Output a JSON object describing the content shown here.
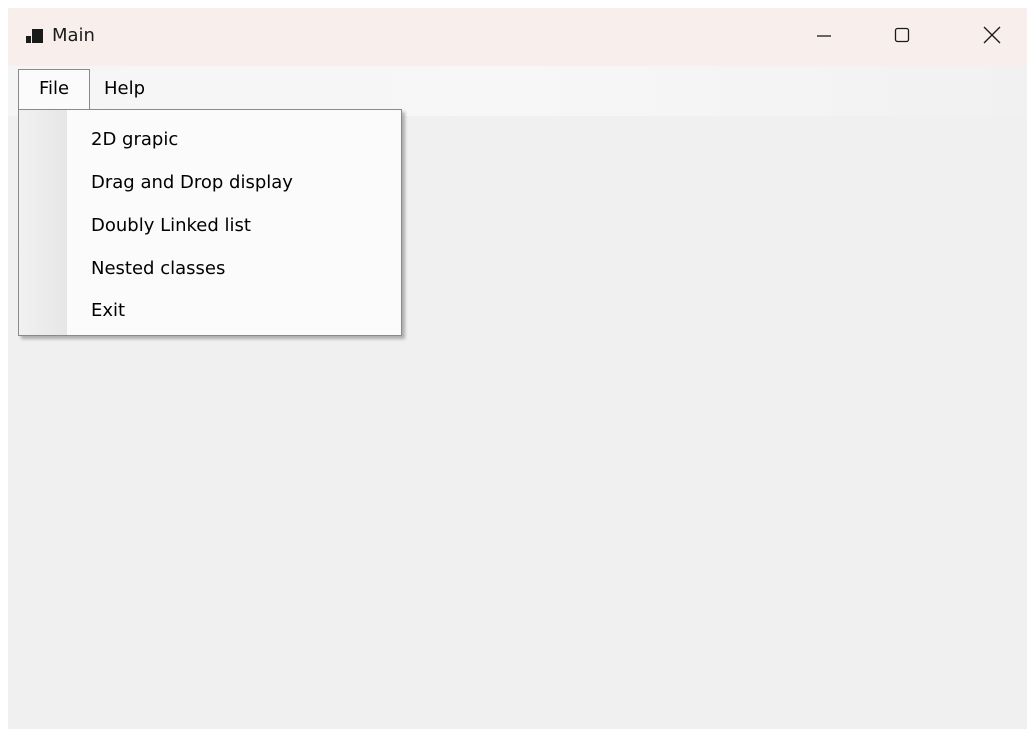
{
  "window": {
    "title": "Main",
    "app_icon": "window-app-icon",
    "caption_buttons": {
      "minimize_icon": "minimize-icon",
      "maximize_icon": "maximize-icon",
      "close_icon": "close-icon"
    }
  },
  "menubar": {
    "items": [
      {
        "label": "File",
        "open": true
      },
      {
        "label": "Help",
        "open": false
      }
    ]
  },
  "file_menu": {
    "items": [
      {
        "label": "2D grapic"
      },
      {
        "label": "Drag and Drop display"
      },
      {
        "label": "Doubly Linked list"
      },
      {
        "label": "Nested classes"
      },
      {
        "label": "Exit"
      }
    ]
  },
  "colors": {
    "titlebar_bg": "#f8efec",
    "client_bg": "#f0f0f0",
    "menu_bg": "#fbfbfb",
    "menu_border": "#8a8a8a"
  }
}
